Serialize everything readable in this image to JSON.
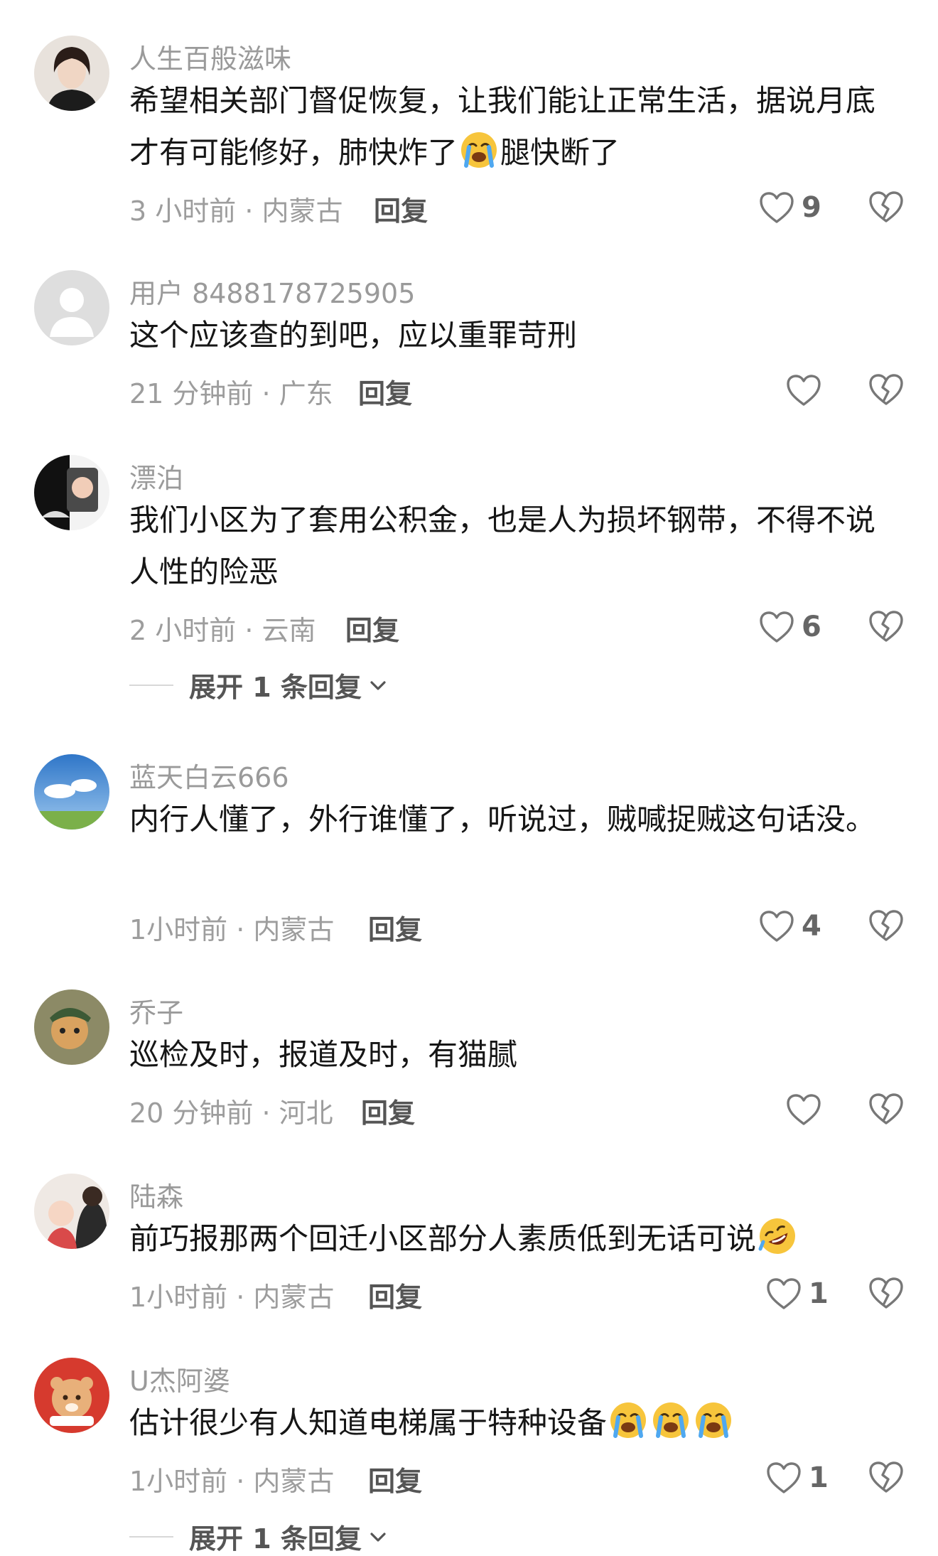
{
  "comments": [
    {
      "username": "人生百般滋味",
      "text_a": "希望相关部门督促恢复，让我们能让正常生活，据说月底才有可能修好，肺快炸了",
      "emoji_a": "crying-face-emoji",
      "text_b": "腿快断了",
      "meta": "3 小时前 · 内蒙古",
      "reply": "回复",
      "likes": "9"
    },
    {
      "username": "用户 8488178725905",
      "text_a": "这个应该查的到吧，应以重罪苛刑",
      "meta": "21 分钟前 · 广东",
      "reply": "回复",
      "likes": ""
    },
    {
      "username": "漂泊",
      "text_a": "我们小区为了套用公积金，也是人为损坏钢带，不得不说人性的险恶",
      "meta": "2 小时前 · 云南",
      "reply": "回复",
      "likes": "6",
      "expand": "展开 1 条回复"
    },
    {
      "username": "蓝天白云666",
      "text_a": "内行人懂了，外行谁懂了，听说过，贼喊捉贼这句话没。",
      "meta": "1小时前 · 内蒙古",
      "reply": "回复",
      "likes": "4"
    },
    {
      "username": "乔子",
      "text_a": "巡检及时，报道及时，有猫腻",
      "meta": "20 分钟前 · 河北",
      "reply": "回复",
      "likes": ""
    },
    {
      "username": "陆森",
      "text_a": "前巧报那两个回迁小区部分人素质低到无话可说",
      "emoji_a": "rolling-laughing-emoji",
      "meta": "1小时前 · 内蒙古",
      "reply": "回复",
      "likes": "1"
    },
    {
      "username": "U杰阿婆",
      "text_a": "估计很少有人知道电梯属于特种设备",
      "emoji_a": "crying-face-emoji",
      "meta": "1小时前 · 内蒙古",
      "reply": "回复",
      "likes": "1",
      "expand": "展开 1 条回复"
    }
  ],
  "colors": {
    "background": "#ffffff",
    "username": "#9a9a9a",
    "text": "#161616",
    "meta": "#9d9d9d",
    "icon": "#777777"
  }
}
